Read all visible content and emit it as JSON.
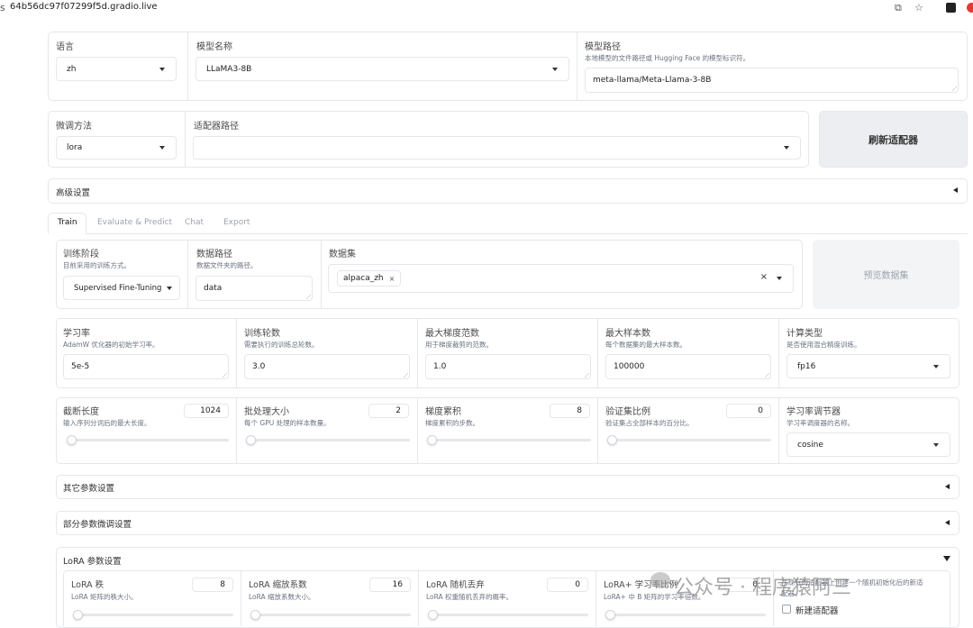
{
  "browser": {
    "url": "64b56dc97f07299f5d.gradio.live",
    "prefix": "s"
  },
  "top": {
    "lang_label": "语言",
    "lang_value": "zh",
    "model_name_label": "模型名称",
    "model_name_value": "LLaMA3-8B",
    "model_path_label": "模型路径",
    "model_path_info": "本地模型的文件路径或 Hugging Face 的模型标识符。",
    "model_path_value": "meta-llama/Meta-Llama-3-8B"
  },
  "finetune": {
    "method_label": "微调方法",
    "method_value": "lora",
    "adapter_label": "适配器路径",
    "adapter_value": "",
    "refresh_button": "刷新适配器"
  },
  "advanced": {
    "title": "高级设置"
  },
  "tabs": [
    {
      "label": "Train",
      "active": true
    },
    {
      "label": "Evaluate & Predict",
      "active": false
    },
    {
      "label": "Chat",
      "active": false
    },
    {
      "label": "Export",
      "active": false
    }
  ],
  "train": {
    "stage_label": "训练阶段",
    "stage_info": "目前采用的训练方式。",
    "stage_value": "Supervised Fine-Tuning",
    "dataset_dir_label": "数据路径",
    "dataset_dir_info": "数据文件夹的路径。",
    "dataset_dir_value": "data",
    "dataset_label": "数据集",
    "dataset_tag": "alpaca_zh",
    "dataset_clear": "×",
    "preview_button": "预览数据集"
  },
  "row1": [
    {
      "label": "学习率",
      "info": "AdamW 优化器的初始学习率。",
      "value": "5e-5"
    },
    {
      "label": "训练轮数",
      "info": "需要执行的训练总轮数。",
      "value": "3.0"
    },
    {
      "label": "最大梯度范数",
      "info": "用于梯度裁剪的范数。",
      "value": "1.0"
    },
    {
      "label": "最大样本数",
      "info": "每个数据集的最大样本数。",
      "value": "100000"
    },
    {
      "label": "计算类型",
      "info": "是否使用混合精度训练。",
      "value": "fp16"
    }
  ],
  "row2": [
    {
      "label": "截断长度",
      "info": "输入序列分词后的最大长度。",
      "value": "1024",
      "level": 0.0
    },
    {
      "label": "批处理大小",
      "info": "每个 GPU 处理的样本数量。",
      "value": "2",
      "level": 0.0
    },
    {
      "label": "梯度累积",
      "info": "梯度累积的步数。",
      "value": "8",
      "level": 0.0
    },
    {
      "label": "验证集比例",
      "info": "验证集占全部样本的百分比。",
      "value": "0",
      "level": 0.0
    },
    {
      "label": "学习率调节器",
      "info": "学习率调度器的名称。",
      "value": "cosine"
    }
  ],
  "other_settings": {
    "title": "其它参数设置"
  },
  "freeze_settings": {
    "title": "部分参数微调设置"
  },
  "lora_settings": {
    "title": "LoRA 参数设置"
  },
  "lora": [
    {
      "label": "LoRA 秩",
      "info": "LoRA 矩阵的秩大小。",
      "value": "8",
      "level": 0.0
    },
    {
      "label": "LoRA 缩放系数",
      "info": "LoRA 缩放系数大小。",
      "value": "16",
      "level": 0.0
    },
    {
      "label": "LoRA 随机丢弃",
      "info": "LoRA 权重随机丢弃的概率。",
      "value": "0",
      "level": 0.0
    },
    {
      "label": "LoRA+ 学习率比例",
      "info": "LoRA+ 中 B 矩阵的学习率倍数。",
      "value": "0",
      "level": 0.0
    }
  ],
  "create_adapter": {
    "info_line1": "在现有的适配器上创建一个随机初始化后的新适",
    "info_line2": "配器。",
    "label": "新建适配器",
    "checked": false
  },
  "watermark": {
    "text": "公众号 · 程序猿阿三"
  },
  "colors": {
    "border": "#e5e7eb",
    "button_bg": "#eceef1",
    "disabled_bg": "#f3f4f6",
    "tab_active": "#111111"
  }
}
